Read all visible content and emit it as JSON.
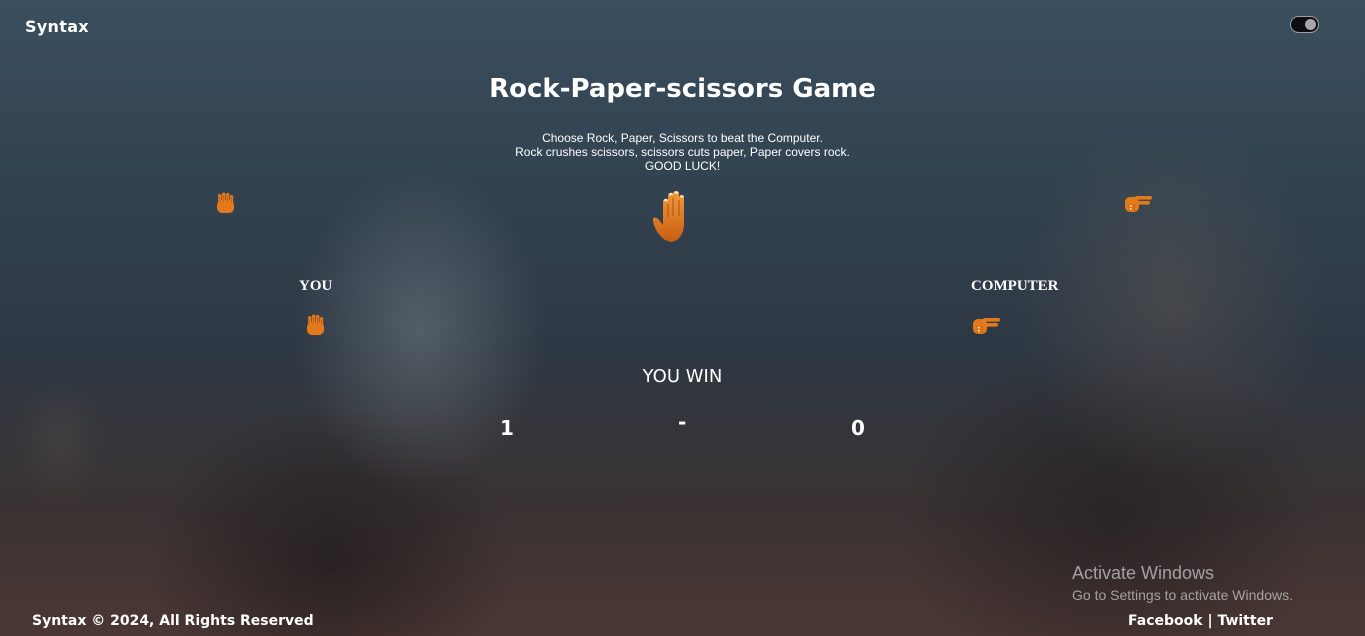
{
  "header": {
    "brand": "Syntax",
    "theme_toggle": {
      "state": "on"
    }
  },
  "game": {
    "title": "Rock-Paper-scissors Game",
    "instructions": [
      "Choose Rock, Paper, Scissors to beat the Computer.",
      "Rock crushes scissors, scissors cuts paper, Paper covers rock.",
      "GOOD LUCK!"
    ],
    "choices": {
      "paper_icon": "raised-hand-icon",
      "rock_icon": "raised-back-of-hand-icon",
      "scissors_icon": "fingers-point-icon"
    },
    "player_label": "YOU",
    "computer_label": "COMPUTER",
    "player_choice_icon": "raised-back-of-hand-icon",
    "computer_choice_icon": "fingers-point-icon",
    "result": "YOU WIN",
    "score": {
      "player": "1",
      "separator": "-",
      "computer": "0"
    }
  },
  "footer": {
    "copyright": "Syntax © 2024, All Rights Reserved",
    "links": [
      "Facebook",
      "Twitter"
    ],
    "link_separator": "|"
  },
  "watermark": {
    "title": "Activate Windows",
    "subtitle": "Go to Settings to activate Windows."
  },
  "colors": {
    "hand": "#e27a1c",
    "hand_dark": "#b75a10",
    "text": "#ffffff"
  }
}
